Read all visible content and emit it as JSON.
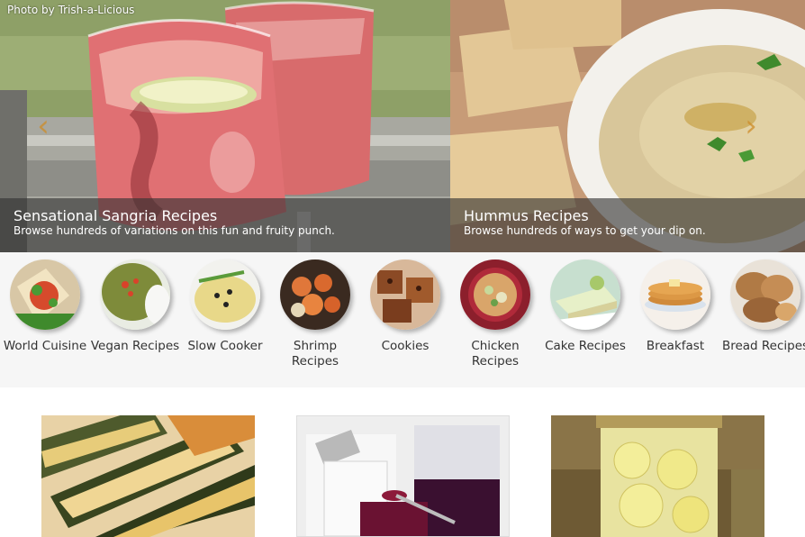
{
  "hero": {
    "photo_credit": "Photo by Trish-a-Licious",
    "slides": [
      {
        "title": "Sensational Sangria Recipes",
        "subtitle": "Browse hundreds of variations on this fun and fruity punch."
      },
      {
        "title": "Hummus Recipes",
        "subtitle": "Browse hundreds of ways to get your dip on."
      }
    ],
    "prev_icon": "chevron-left-icon",
    "next_icon": "chevron-right-icon"
  },
  "categories": [
    {
      "label": "World Cuisine"
    },
    {
      "label": "Vegan Recipes"
    },
    {
      "label": "Slow Cooker"
    },
    {
      "label": "Shrimp Recipes"
    },
    {
      "label": "Cookies"
    },
    {
      "label": "Chicken Recipes"
    },
    {
      "label": "Cake Recipes"
    },
    {
      "label": "Breakfast"
    },
    {
      "label": "Bread Recipes"
    }
  ],
  "colors": {
    "caption_bg": "rgba(50,50,50,0.62)",
    "strip_bg": "#f6f6f6",
    "label_text": "#333333"
  }
}
